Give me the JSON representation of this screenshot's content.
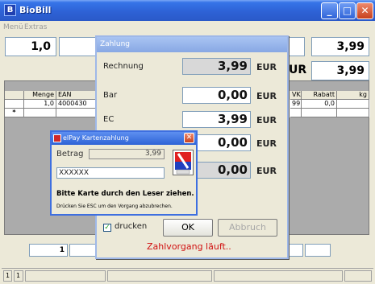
{
  "window": {
    "title": "BioBill",
    "app_icon_glyph": "B"
  },
  "menu": {
    "items": [
      "Menü",
      "Extras"
    ]
  },
  "top": {
    "qty_value": "1,0",
    "right_value_1": "3,99",
    "right_value_2": "3,99",
    "partial_label": "UR",
    "mid_partial": "R"
  },
  "grid": {
    "headers": [
      "",
      "Menge",
      "EAN",
      "VK",
      "Rabatt",
      "kg"
    ],
    "rows": [
      {
        "marker": "",
        "menge": "1,0",
        "ean": "4000430",
        "vk": "99",
        "rabatt": "0,0",
        "kg": ""
      },
      {
        "marker": "*",
        "menge": "",
        "ean": "",
        "vk": "",
        "rabatt": "",
        "kg": ""
      }
    ]
  },
  "bottom": {
    "field_value": "1"
  },
  "statusbar": {
    "pane1": "1",
    "pane2": "1"
  },
  "zahlung": {
    "title": "Zahlung",
    "rows": [
      {
        "label": "Rechnung",
        "value": "3,99",
        "currency": "EUR"
      },
      {
        "label": "Bar",
        "value": "0,00",
        "currency": "EUR"
      },
      {
        "label": "EC",
        "value": "3,99",
        "currency": "EUR"
      },
      {
        "label": "",
        "value": "0,00",
        "currency": "EUR"
      },
      {
        "label": "",
        "value": "0,00",
        "currency": "EUR"
      }
    ],
    "print_checkbox_label": "drucken",
    "print_checked": true,
    "ok_label": "OK",
    "cancel_label": "Abbruch",
    "status_text": "Zahlvorgang läuft..",
    "status_color": "#d01010"
  },
  "elpay": {
    "title": "elPay Kartenzahlung",
    "betrag_label": "Betrag",
    "betrag_value": "3,99",
    "card_number": "XXXXXX",
    "instruction": "Bitte Karte durch den Leser ziehen.",
    "hint": "Drücken Sie ESC um den Vorgang abzubrechen.",
    "icon": "card-reader-icon"
  },
  "colors": {
    "title_blue": "#2e62d6",
    "accent_red": "#d01010"
  }
}
